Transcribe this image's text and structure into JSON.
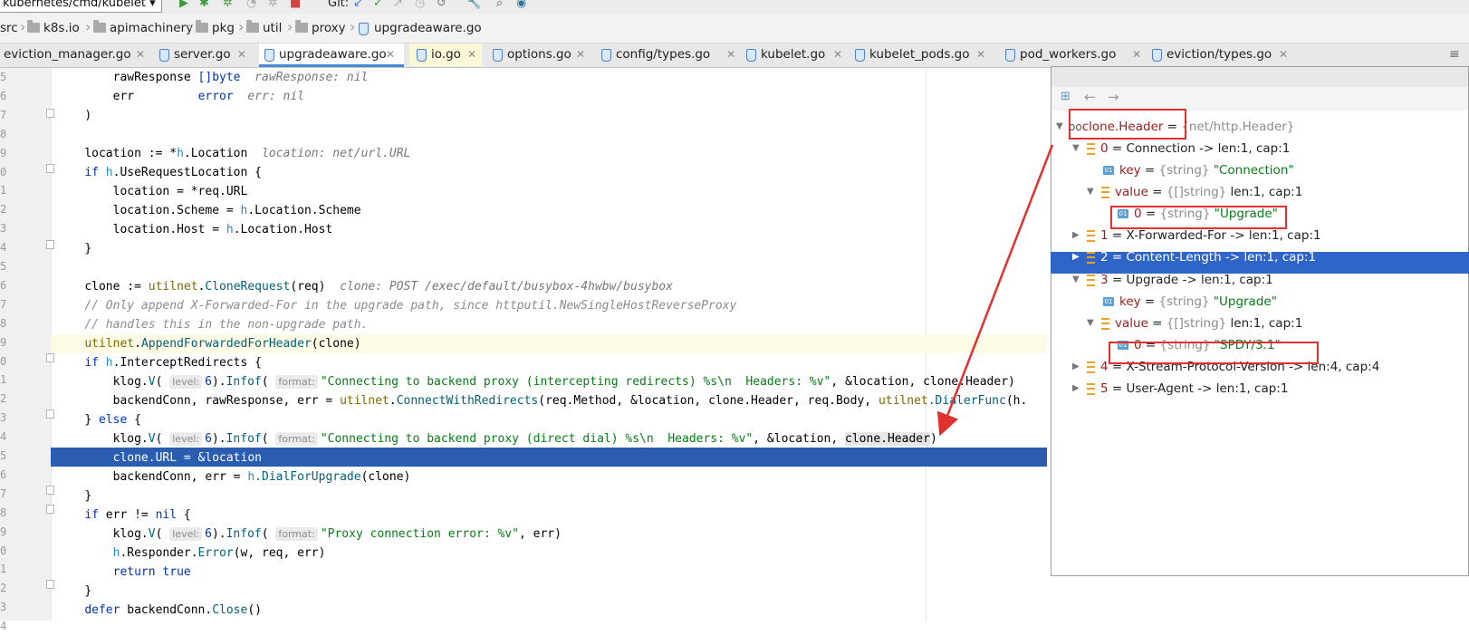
{
  "toolbar": {
    "run_config": "kubernetes/cmd/kubelet",
    "git_label": "Git:"
  },
  "breadcrumbs": [
    "src",
    "k8s.io",
    "apimachinery",
    "pkg",
    "util",
    "proxy",
    "upgradeaware.go"
  ],
  "tabs": [
    "eviction_manager.go",
    "server.go",
    "upgradeaware.go",
    "io.go",
    "options.go",
    "config/types.go",
    "kubelet.go",
    "kubelet_pods.go",
    "pod_workers.go",
    "eviction/types.go"
  ],
  "line_numbers": [
    "5",
    "6",
    "7",
    "8",
    "9",
    "0",
    "1",
    "2",
    "3",
    "4",
    "5",
    "6",
    "7",
    "8",
    "9",
    "0",
    "1",
    "2",
    "3",
    "4",
    "5",
    "6",
    "7",
    "8",
    "9",
    "0",
    "1",
    "2",
    "3",
    "4"
  ],
  "code": {
    "l1_name": "rawResponse",
    "l1_type": "[]byte",
    "l1_hint": "rawResponse: nil",
    "l2_name": "err",
    "l2_type": "error",
    "l2_hint": "err: nil",
    "l3": ")",
    "l5_a": "location := *",
    "l5_h": "h",
    "l5_b": ".Location",
    "l5_hint": "location: net/url.URL",
    "l6_if": "if",
    "l6_h": "h",
    "l6_b": ".UseRequestLocation {",
    "l7": "location = *req.URL",
    "l8_a": "location.Scheme = ",
    "l8_h": "h",
    "l8_b": ".Location.Scheme",
    "l9_a": "location.Host = ",
    "l9_h": "h",
    "l9_b": ".Location.Host",
    "l10": "}",
    "l12_a": "clone := ",
    "l12_pkg": "utilnet",
    "l12_dot": ".",
    "l12_fn": "CloneRequest",
    "l12_b": "(req)",
    "l12_hint": "clone: POST /exec/default/busybox-4hwbw/busybox",
    "l13": "// Only append X-Forwarded-For in the upgrade path, since httputil.NewSingleHostReverseProxy",
    "l14": "// handles this in the non-upgrade path.",
    "l15_pkg": "utilnet",
    "l15_dot": ".",
    "l15_fn": "AppendForwardedForHeader",
    "l15_b": "(clone)",
    "l16_if": "if",
    "l16_h": "h",
    "l16_b": ".InterceptRedirects {",
    "l17_a": "klog.",
    "l17_v": "V",
    "l17_p1": "level:",
    "l17_n": "6",
    "l17_c": ").",
    "l17_fn": "Infof",
    "l17_o": "(",
    "l17_p2": "format:",
    "l17_s": "\"Connecting to backend proxy (intercepting redirects) %s\\n  Headers: %v\"",
    "l17_e": ", &location, clone.Header)",
    "l18_a": "backendConn, rawResponse, err = ",
    "l18_pkg": "utilnet",
    "l18_dot": ".",
    "l18_fn": "ConnectWithRedirects",
    "l18_b": "(req.Method, &location, clone.Header, req.Body, ",
    "l18_pkg2": "utilnet",
    "l18_fn2": ".DialerFunc",
    "l18_c": "(h.",
    "l19_a": "} ",
    "l19_else": "else",
    "l19_b": " {",
    "l20_a": "klog.",
    "l20_v": "V",
    "l20_p1": "level:",
    "l20_n": "6",
    "l20_c": ").",
    "l20_fn": "Infof",
    "l20_o": "(",
    "l20_p2": "format:",
    "l20_s": "\"Connecting to backend proxy (direct dial) %s\\n  Headers: %v\"",
    "l20_e": ", &location, ",
    "l20_sel": "clone.Header",
    "l20_end": ")",
    "l21": "clone.URL = &location",
    "l22_a": "backendConn, err = ",
    "l22_h": "h",
    "l22_fn": ".DialForUpgrade",
    "l22_b": "(clone)",
    "l23": "}",
    "l24_if": "if",
    "l24_a": " err != ",
    "l24_nil": "nil",
    "l24_b": " {",
    "l25_a": "klog.",
    "l25_v": "V",
    "l25_p1": "level:",
    "l25_n": "6",
    "l25_c": ").",
    "l25_fn": "Infof",
    "l25_o": "(",
    "l25_p2": "format:",
    "l25_s": "\"Proxy connection error: %v\"",
    "l25_e": ", err)",
    "l26_h": "h",
    "l26_a": ".Responder.",
    "l26_fn": "Error",
    "l26_b": "(w, req, err)",
    "l27_ret": "return",
    "l27_true": "true",
    "l28": "}",
    "l29_defer": "defer",
    "l29_a": " backendConn.",
    "l29_fn": "Close",
    "l29_b": "()"
  },
  "debugger": {
    "root": {
      "name": "clone.Header",
      "eq": "=",
      "type": "{net/http.Header}"
    },
    "items": [
      {
        "index": "0",
        "summary": "Connection -> len:1, cap:1"
      },
      {
        "key_label": "key",
        "key_type": "{string}",
        "key_value": "\"Connection\""
      },
      {
        "value_label": "value",
        "value_type": "{[]string}",
        "value_summary": "len:1, cap:1"
      },
      {
        "index": "0",
        "type": "{string}",
        "value": "\"Upgrade\""
      },
      {
        "index": "1",
        "summary": "X-Forwarded-For -> len:1, cap:1"
      },
      {
        "index": "2",
        "summary": "Content-Length -> len:1, cap:1"
      },
      {
        "index": "3",
        "summary": "Upgrade -> len:1, cap:1"
      },
      {
        "key_label": "key",
        "key_type": "{string}",
        "key_value": "\"Upgrade\""
      },
      {
        "value_label": "value",
        "value_type": "{[]string}",
        "value_summary": "len:1, cap:1"
      },
      {
        "index": "0",
        "type": "{string}",
        "value": "\"SPDY/3.1\""
      },
      {
        "index": "4",
        "summary": "X-Stream-Protocol-Version -> len:4, cap:4"
      },
      {
        "index": "5",
        "summary": "User-Agent -> len:1, cap:1"
      }
    ]
  },
  "colors": {
    "annotation": "#e0312f",
    "selection": "#2f65c8",
    "exec_line": "#2a5db0"
  }
}
